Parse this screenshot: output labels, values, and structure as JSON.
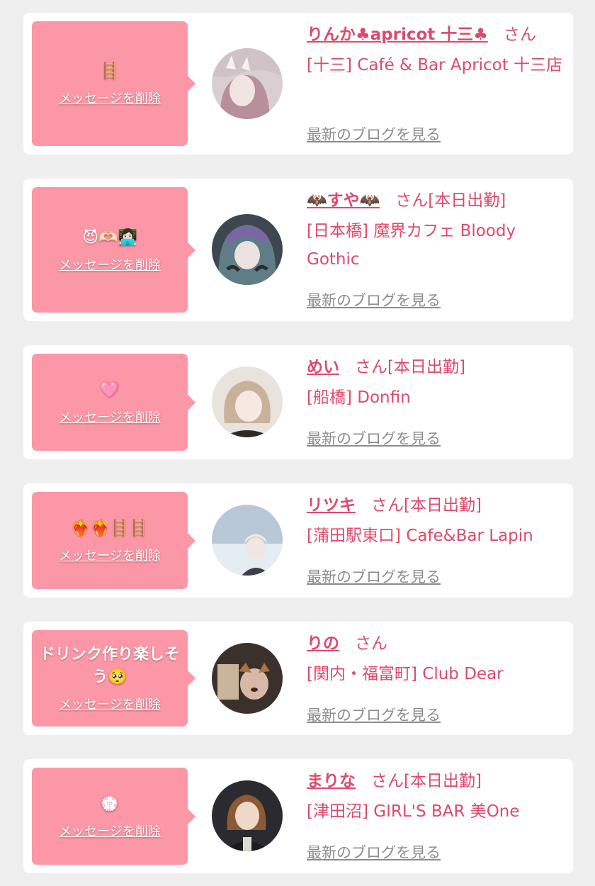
{
  "colors": {
    "bubble": "#fb97a6",
    "accent": "#dd4a6c",
    "link_gray": "#8c8c8c",
    "background": "#efefef"
  },
  "cards": [
    {
      "message": "🪜",
      "delete_label": "メッセージを削除",
      "name": "りんか♣apricot 十三♣",
      "suffix": "さん",
      "shop": "[十三] Café & Bar Apricot 十三店",
      "blog_label": "最新のブログを見る",
      "avatar_icon": "profile-photo"
    },
    {
      "message": "😈🫶🏻👩🏻‍💻",
      "delete_label": "メッセージを削除",
      "name": "🦇すや🦇",
      "suffix": "さん[本日出勤]",
      "shop": "[日本橋] 魔界カフェ Bloody Gothic",
      "blog_label": "最新のブログを見る",
      "avatar_icon": "profile-photo"
    },
    {
      "message": "🩷",
      "delete_label": "メッセージを削除",
      "name": "めい",
      "suffix": "さん[本日出勤]",
      "shop": "[船橋] Donfin",
      "blog_label": "最新のブログを見る",
      "avatar_icon": "profile-photo"
    },
    {
      "message": "❤️‍🔥❤️‍🔥🪜🪜",
      "delete_label": "メッセージを削除",
      "name": "リツキ",
      "suffix": "さん[本日出勤]",
      "shop": "[蒲田駅東口] Cafe&Bar Lapin",
      "blog_label": "最新のブログを見る",
      "avatar_icon": "profile-photo"
    },
    {
      "message": "ドリンク作り楽しそう🥺",
      "delete_label": "メッセージを削除",
      "name": "りの",
      "suffix": "さん",
      "shop": "[関内・福富町] Club Dear",
      "blog_label": "最新のブログを見る",
      "avatar_icon": "profile-photo"
    },
    {
      "message": "💮",
      "delete_label": "メッセージを削除",
      "name": "まりな",
      "suffix": "さん[本日出勤]",
      "shop": "[津田沼] GIRL'S BAR 美One",
      "blog_label": "最新のブログを見る",
      "avatar_icon": "profile-photo"
    }
  ]
}
